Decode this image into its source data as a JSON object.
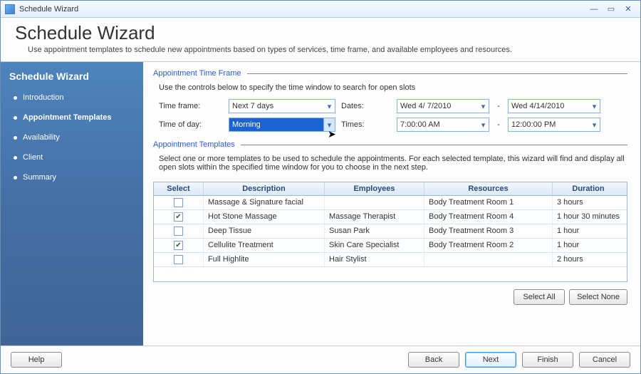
{
  "titlebar": {
    "title": "Schedule Wizard"
  },
  "header": {
    "title": "Schedule Wizard",
    "subtitle": "Use appointment templates to schedule new appointments based on types of services, time frame, and available employees and resources."
  },
  "sidebar": {
    "title": "Schedule Wizard",
    "items": [
      {
        "label": "Introduction",
        "active": false
      },
      {
        "label": "Appointment Templates",
        "active": true
      },
      {
        "label": "Availability",
        "active": false
      },
      {
        "label": "Client",
        "active": false
      },
      {
        "label": "Summary",
        "active": false
      }
    ]
  },
  "sections": {
    "timeframe_title": "Appointment Time Frame",
    "timeframe_desc": "Use the controls below to specify the time window to search for open slots",
    "templates_title": "Appointment Templates",
    "templates_desc": "Select one or more templates to be used to schedule the appointments.  For each selected template, this wizard will find and display all open slots within the specified time window for you to choose in the next step."
  },
  "controls": {
    "timeframe_label": "Time frame:",
    "timeofday_label": "Time of day:",
    "dates_label": "Dates:",
    "times_label": "Times:",
    "dash": "-",
    "timeframe_value": "Next 7 days",
    "timeofday_value": "Morning",
    "date_start": "Wed   4/ 7/2010",
    "date_end": "Wed   4/14/2010",
    "time_start": "7:00:00 AM",
    "time_end": "12:00:00 PM"
  },
  "table": {
    "headers": {
      "select": "Select",
      "description": "Description",
      "employees": "Employees",
      "resources": "Resources",
      "duration": "Duration"
    },
    "rows": [
      {
        "selected": false,
        "description": "Massage & Signature facial",
        "employees": "",
        "resources": "Body Treatment Room 1",
        "duration": "3 hours"
      },
      {
        "selected": true,
        "description": "Hot Stone Massage",
        "employees": "Massage Therapist",
        "resources": "Body Treatment Room 4",
        "duration": "1 hour 30 minutes"
      },
      {
        "selected": false,
        "description": "Deep Tissue",
        "employees": "Susan Park",
        "resources": "Body Treatment Room 3",
        "duration": "1 hour"
      },
      {
        "selected": true,
        "description": "Cellulite Treatment",
        "employees": "Skin Care Specialist",
        "resources": "Body Treatment Room 2",
        "duration": "1 hour"
      },
      {
        "selected": false,
        "description": "Full Highlite",
        "employees": "Hair Stylist",
        "resources": "",
        "duration": "2 hours"
      }
    ]
  },
  "buttons": {
    "select_all": "Select All",
    "select_none": "Select None",
    "help": "Help",
    "back": "Back",
    "next": "Next",
    "finish": "Finish",
    "cancel": "Cancel"
  }
}
